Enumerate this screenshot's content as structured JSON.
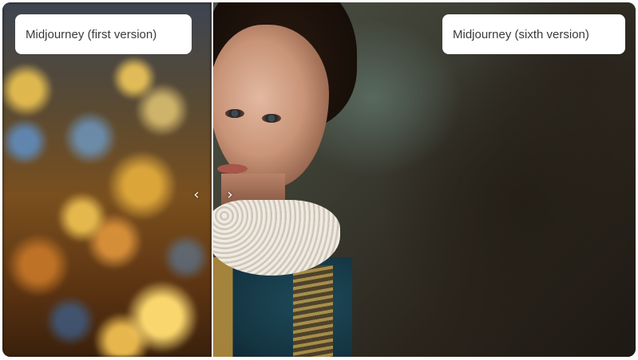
{
  "comparison": {
    "left_label": "Midjourney (first version)",
    "right_label": "Midjourney (sixth version)",
    "prev_arrow": "‹",
    "next_arrow": "›"
  },
  "icons": {
    "prev": "chevron-left-icon",
    "next": "chevron-right-icon"
  },
  "colors": {
    "label_bg": "#ffffff",
    "label_text": "#3a3a3a",
    "divider": "#f2f2f2"
  }
}
